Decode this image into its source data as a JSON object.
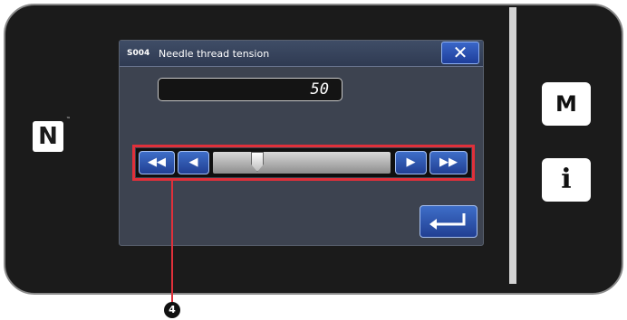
{
  "side_panel": {
    "nfc_symbol": "N",
    "nfc_trademark": "™",
    "menu_button_label": "M",
    "info_button_label": "i"
  },
  "dialog": {
    "code": "S004",
    "title": "Needle thread tension",
    "close_icon": "close-icon",
    "value": "50",
    "slider": {
      "position_fraction": 0.25,
      "fast_decrease_symbol": "◀◀",
      "decrease_symbol": "◀",
      "increase_symbol": "▶",
      "fast_increase_symbol": "▶▶"
    },
    "enter_icon": "enter-icon"
  },
  "callout": {
    "number": "4"
  },
  "colors": {
    "callout_red": "#e0303a",
    "button_blue": "#2f57b5",
    "screen_bg": "#3d4350",
    "titlebar_bg": "#354360"
  }
}
